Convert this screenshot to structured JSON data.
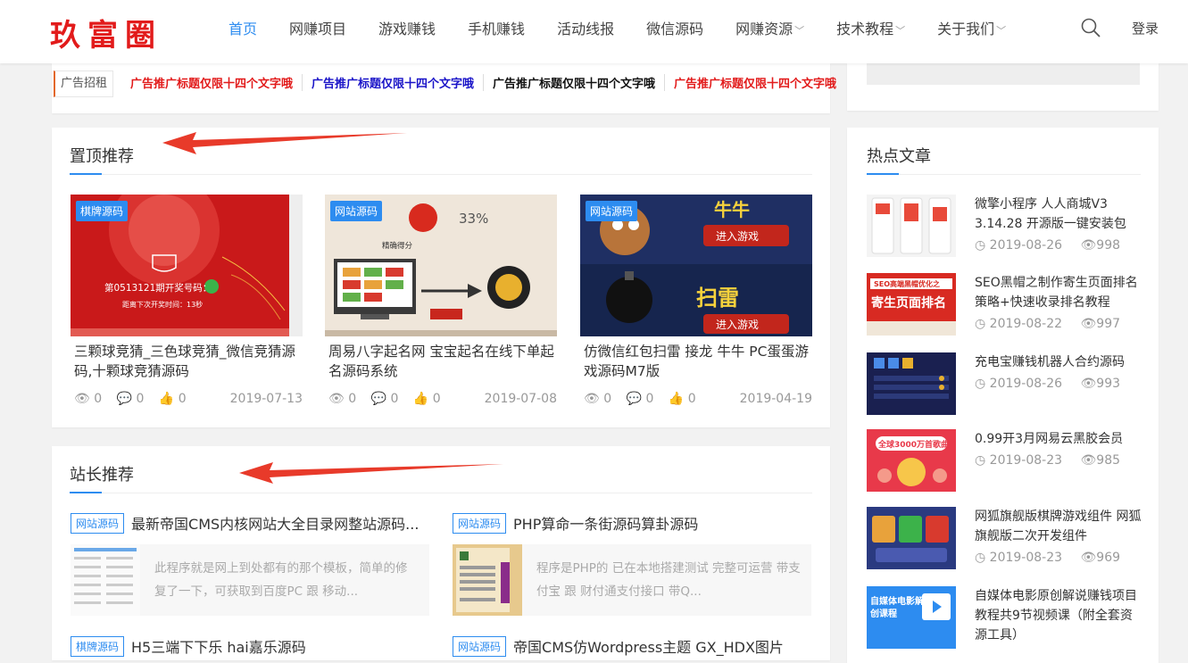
{
  "header": {
    "logo": "玖富圈",
    "nav": [
      {
        "label": "首页",
        "active": true,
        "dropdown": false
      },
      {
        "label": "网赚项目",
        "active": false,
        "dropdown": false
      },
      {
        "label": "游戏赚钱",
        "active": false,
        "dropdown": false
      },
      {
        "label": "手机赚钱",
        "active": false,
        "dropdown": false
      },
      {
        "label": "活动线报",
        "active": false,
        "dropdown": false
      },
      {
        "label": "微信源码",
        "active": false,
        "dropdown": false
      },
      {
        "label": "网赚资源",
        "active": false,
        "dropdown": true
      },
      {
        "label": "技术教程",
        "active": false,
        "dropdown": true
      },
      {
        "label": "关于我们",
        "active": false,
        "dropdown": true
      }
    ],
    "login": "登录",
    "accent": "#2d8cf0"
  },
  "ad": {
    "label": "广告招租",
    "links": [
      {
        "text": "广告推广标题仅限十四个文字哦",
        "color": "#e21b1b"
      },
      {
        "text": "广告推广标题仅限十四个文字哦",
        "color": "#1a14c8"
      },
      {
        "text": "广告推广标题仅限十四个文字哦",
        "color": "#111111"
      },
      {
        "text": "广告推广标题仅限十四个文字哦",
        "color": "#e21b1b"
      }
    ]
  },
  "top": {
    "title": "置顶推荐",
    "posts": [
      {
        "tag": "棋牌源码",
        "title": "三颗球竞猜_三色球竞猜_微信竞猜源码,十颗球竞猜源码",
        "views": "0",
        "comments": "0",
        "likes": "0",
        "date": "2019-07-13",
        "img_text1": "第0513121期开奖号码：",
        "img_text2": "距离下次开奖时间：13秒"
      },
      {
        "tag": "网站源码",
        "title": "周易八字起名网 宝宝起名在线下单起名源码系统",
        "views": "0",
        "comments": "0",
        "likes": "0",
        "date": "2019-07-08",
        "img_text1": "精确得分",
        "img_text2": "33%"
      },
      {
        "tag": "网站源码",
        "title": "仿微信红包扫雷 接龙 牛牛 PC蛋蛋游戏源码M7版",
        "views": "0",
        "comments": "0",
        "likes": "0",
        "date": "2019-04-19",
        "img_text1": "牛牛",
        "img_text2": "扫雷",
        "img_btn": "进入游戏"
      }
    ]
  },
  "boss": {
    "title": "站长推荐",
    "items": [
      {
        "tag": "网站源码",
        "title": "最新帝国CMS内核网站大全目录网整站源码...",
        "excerpt": "此程序就是网上到处都有的那个模板，简单的修复了一下，可获取到百度PC 跟 移动..."
      },
      {
        "tag": "网站源码",
        "title": "PHP算命一条街源码算卦源码",
        "excerpt": "程序是PHP的 已在本地搭建测试 完整可运营 带支付宝 跟 财付通支付接口 带Q..."
      },
      {
        "tag": "棋牌源码",
        "title": "H5三端下下乐 hai嘉乐源码",
        "excerpt": ""
      },
      {
        "tag": "网站源码",
        "title": "帝国CMS仿Wordpress主题 GX_HDX图片",
        "excerpt": ""
      }
    ]
  },
  "hot": {
    "title": "热点文章",
    "items": [
      {
        "title": "微擎小程序 人人商城V3 3.14.28 开源版一键安装包",
        "date": "2019-08-26",
        "views": "998"
      },
      {
        "title": "SEO黑帽之制作寄生页面排名策略+快速收录排名教程",
        "date": "2019-08-22",
        "views": "997",
        "img_text1": "SEO高端黑帽优化之",
        "img_text2": "寄生页面排名"
      },
      {
        "title": "充电宝赚钱机器人合约源码",
        "date": "2019-08-26",
        "views": "993"
      },
      {
        "title": "0.99开3月网易云黑胶会员",
        "date": "2019-08-23",
        "views": "985",
        "img_text1": "全球3000万首歌曲"
      },
      {
        "title": "网狐旗舰版棋牌游戏组件 网狐旗舰版二次开发组件",
        "date": "2019-08-23",
        "views": "969"
      },
      {
        "title": "自媒体电影原创解说赚钱项目教程共9节视频课（附全套资源工具）",
        "date": "",
        "views": "",
        "img_text1": "自媒体电影解说",
        "img_text2": "创课程"
      }
    ]
  }
}
